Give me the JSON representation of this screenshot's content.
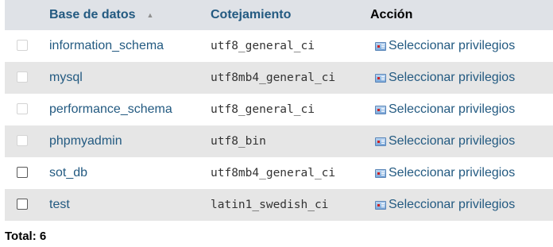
{
  "table": {
    "headers": {
      "database": "Base de datos",
      "sort_indicator": "▲",
      "collation": "Cotejamiento",
      "action": "Acción"
    },
    "rows": [
      {
        "name": "information_schema",
        "collation": "utf8_general_ci",
        "action": "Seleccionar privilegios",
        "checkbox_enabled": false
      },
      {
        "name": "mysql",
        "collation": "utf8mb4_general_ci",
        "action": "Seleccionar privilegios",
        "checkbox_enabled": false
      },
      {
        "name": "performance_schema",
        "collation": "utf8_general_ci",
        "action": "Seleccionar privilegios",
        "checkbox_enabled": false
      },
      {
        "name": "phpmyadmin",
        "collation": "utf8_bin",
        "action": "Seleccionar privilegios",
        "checkbox_enabled": false
      },
      {
        "name": "sot_db",
        "collation": "utf8mb4_general_ci",
        "action": "Seleccionar privilegios",
        "checkbox_enabled": true
      },
      {
        "name": "test",
        "collation": "latin1_swedish_ci",
        "action": "Seleccionar privilegios",
        "checkbox_enabled": true
      }
    ],
    "action_icon": "privileges-icon"
  },
  "footer": {
    "total_label": "Total: 6"
  }
}
